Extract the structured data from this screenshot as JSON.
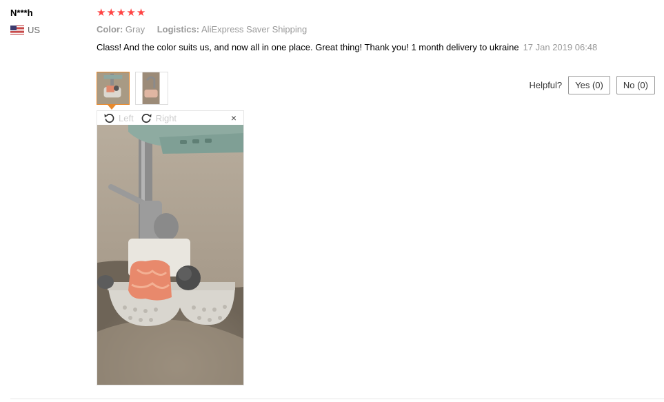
{
  "reviewer": {
    "name": "N***h",
    "country": "US",
    "flag_icon": "us-flag-icon"
  },
  "rating": {
    "stars": 5,
    "max": 5,
    "color": "#ff4747"
  },
  "attributes": {
    "color_label": "Color:",
    "color_value": "Gray",
    "logistics_label": "Logistics:",
    "logistics_value": "AliExpress Saver Shipping"
  },
  "review": {
    "text": "Class! And the color suits us, and now all in one place. Great thing! Thank you! 1 month delivery to ukraine",
    "date": "17 Jan 2019 06:48"
  },
  "helpful": {
    "label": "Helpful?",
    "yes_label": "Yes (0)",
    "no_label": "No (0)"
  },
  "viewer": {
    "rotate_left_label": "Left",
    "rotate_right_label": "Right",
    "close_symbol": "×"
  },
  "colors": {
    "accent": "#e8892b",
    "star": "#ff4747"
  }
}
